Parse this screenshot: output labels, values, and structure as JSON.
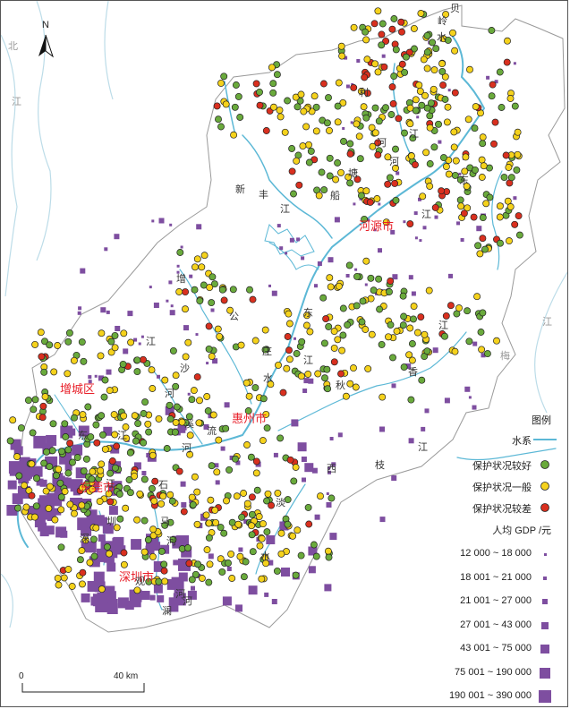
{
  "north": {
    "label": "N"
  },
  "cities": [
    {
      "id": "heyuan",
      "name": "河源市"
    },
    {
      "id": "huizhou",
      "name": "惠州市"
    },
    {
      "id": "zengcheng",
      "name": "增城区"
    },
    {
      "id": "dongguan",
      "name": "东莞市"
    },
    {
      "id": "shenzhen",
      "name": "深圳市"
    }
  ],
  "river_glyphs": [
    "贝",
    "岭",
    "水",
    "利",
    "河",
    "江",
    "东",
    "江",
    "新",
    "丰",
    "江",
    "船",
    "塘",
    "河",
    "增",
    "公",
    "庄",
    "江",
    "沙",
    "河",
    "水",
    "东",
    "江",
    "秋",
    "香",
    "江",
    "流",
    "溪",
    "河",
    "东",
    "江",
    "西",
    "枝",
    "江",
    "江",
    "石",
    "马",
    "河",
    "淡",
    "水",
    "河",
    "观",
    "澜",
    "河",
    "深",
    "圳",
    "河",
    "茅",
    "洲",
    "河"
  ],
  "outside_glyphs": [
    "北",
    "江",
    "梅",
    "江"
  ],
  "scale": {
    "zero": "0",
    "distance": "40 km"
  },
  "legend": {
    "title": "图例",
    "water_label": "水系",
    "water_color": "#5cb8d6",
    "points": [
      {
        "label": "保护状况较好",
        "color": "#6aaa3c"
      },
      {
        "label": "保护状况一般",
        "color": "#f5d21c"
      },
      {
        "label": "保护状况较差",
        "color": "#d9301f"
      }
    ],
    "gdp_title": "人均 GDP /元",
    "gdp_color": "#7e4ea0",
    "gdp_classes": [
      "12 000 ~ 18 000",
      "18 001 ~ 21 000",
      "21 001 ~ 27 000",
      "27 001 ~ 43 000",
      "43 001 ~ 75 000",
      "75 001 ~ 190 000",
      "190 001 ~ 390 000"
    ]
  }
}
